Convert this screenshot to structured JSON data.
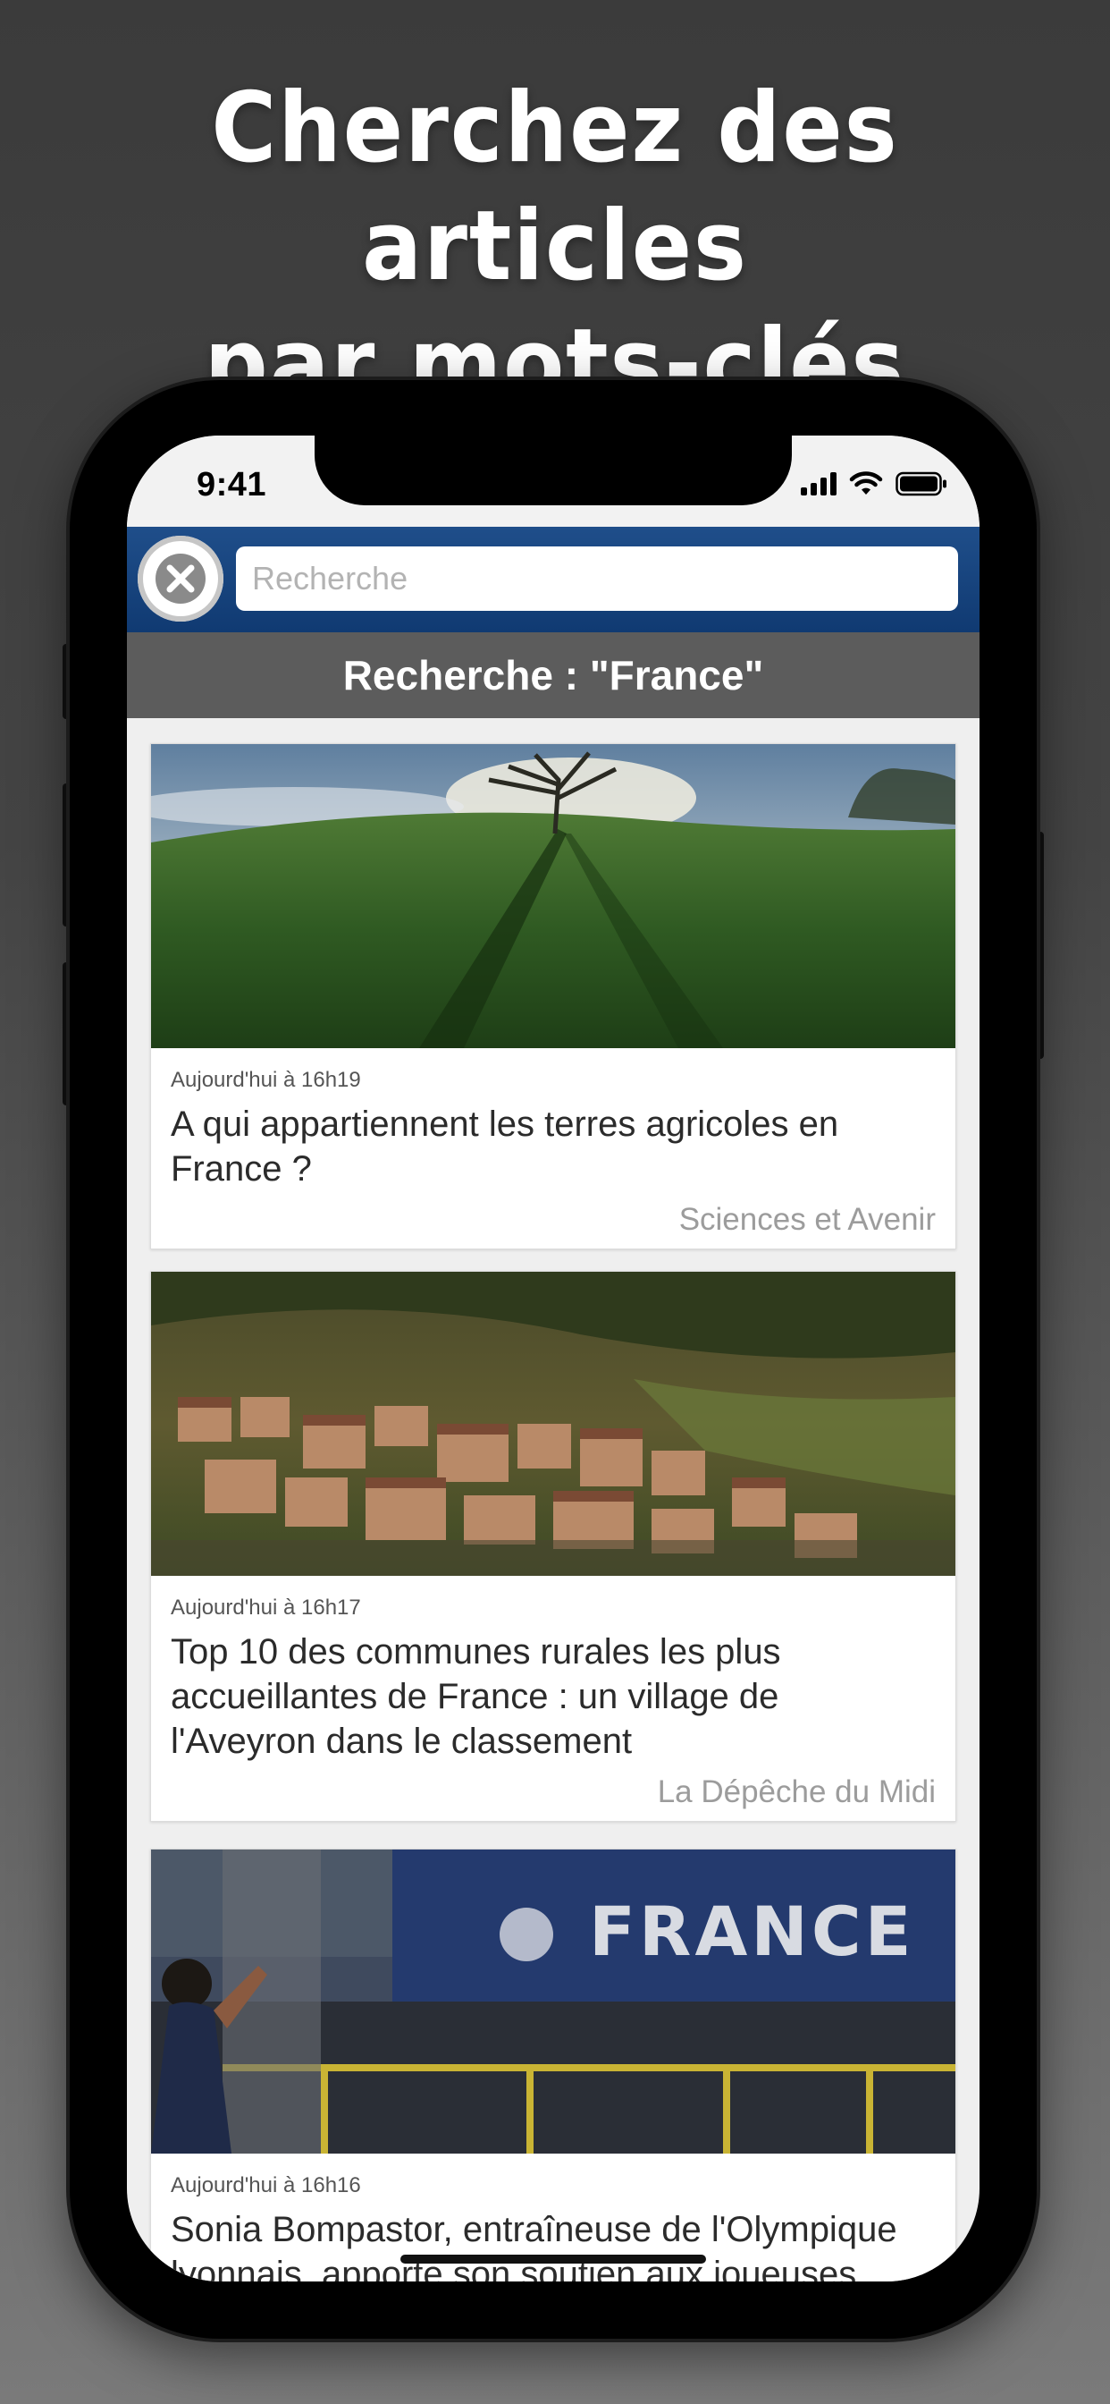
{
  "promo": {
    "line1": "Cherchez des articles",
    "line2": "par mots-clés"
  },
  "status_bar": {
    "time": "9:41",
    "icons": [
      "signal-icon",
      "wifi-icon",
      "battery-icon"
    ]
  },
  "search": {
    "placeholder": "Recherche",
    "value": "",
    "close_icon": "close-icon"
  },
  "results_header": {
    "title": "Recherche : \"France\""
  },
  "articles": [
    {
      "date": "Aujourd'hui à 16h19",
      "title": "A qui appartiennent les terres agricoles en France ?",
      "source": "Sciences et Avenir",
      "image": "tree-on-grassy-hill-photo"
    },
    {
      "date": "Aujourd'hui à 16h17",
      "title": "Top 10 des communes rurales les plus accueillantes de France : un village de l'Aveyron dans le classement",
      "source": "La Dépêche du Midi",
      "image": "hillside-village-photo"
    },
    {
      "date": "Aujourd'hui à 16h16",
      "title": "Sonia Bompastor, entraîneuse de l'Olympique lyonnais, apporte son soutien aux joueuses",
      "source": "",
      "image": "france-stadium-player-photo",
      "image_banner": "FRANCE"
    }
  ],
  "colors": {
    "header_blue": "#12427c",
    "results_bar": "#5c5c5c",
    "list_background": "#efefef"
  }
}
